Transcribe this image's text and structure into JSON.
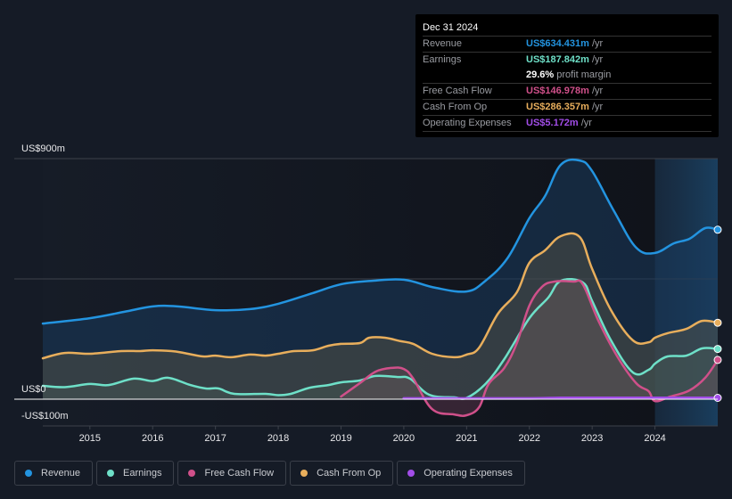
{
  "tooltip": {
    "date": "Dec 31 2024",
    "rows": [
      {
        "label": "Revenue",
        "value": "US$634.431m",
        "unit": "/yr",
        "color": "#2394e0"
      },
      {
        "label": "Earnings",
        "value": "US$187.842m",
        "unit": "/yr",
        "color": "#6ee0c8"
      },
      {
        "label": "",
        "value": "29.6%",
        "unit": "profit margin",
        "color": "#ffffff"
      },
      {
        "label": "Free Cash Flow",
        "value": "US$146.978m",
        "unit": "/yr",
        "color": "#d0508a"
      },
      {
        "label": "Cash From Op",
        "value": "US$286.357m",
        "unit": "/yr",
        "color": "#e8ae5c"
      },
      {
        "label": "Operating Expenses",
        "value": "US$5.172m",
        "unit": "/yr",
        "color": "#a24de8"
      }
    ]
  },
  "legend": [
    {
      "label": "Revenue",
      "color": "#2394e0"
    },
    {
      "label": "Earnings",
      "color": "#6ee0c8"
    },
    {
      "label": "Free Cash Flow",
      "color": "#d0508a"
    },
    {
      "label": "Cash From Op",
      "color": "#e8ae5c"
    },
    {
      "label": "Operating Expenses",
      "color": "#a24de8"
    }
  ],
  "chart_data": {
    "type": "area",
    "title": "",
    "xlabel": "",
    "ylabel": "",
    "ylim": [
      -100,
      900
    ],
    "xlim": [
      2014.25,
      2025.0
    ],
    "y_tick_labels": [
      {
        "value": 900,
        "label": "US$900m"
      },
      {
        "value": 0,
        "label": "US$0"
      },
      {
        "value": -100,
        "label": "-US$100m"
      }
    ],
    "gridlines": [
      900,
      450
    ],
    "x_ticks": [
      2015,
      2016,
      2017,
      2018,
      2019,
      2020,
      2021,
      2022,
      2023,
      2024
    ],
    "highlight_from": 2024.0,
    "units": "US$ millions",
    "series": [
      {
        "name": "Revenue",
        "color": "#2394e0",
        "x": [
          2014.25,
          2015.0,
          2015.55,
          2016.0,
          2016.4,
          2017.0,
          2017.55,
          2018.0,
          2018.55,
          2019.0,
          2019.5,
          2020.0,
          2020.5,
          2021.0,
          2021.3,
          2021.65,
          2022.0,
          2022.25,
          2022.5,
          2022.8,
          2023.0,
          2023.35,
          2023.7,
          2024.0,
          2024.3,
          2024.55,
          2024.8,
          2025.0
        ],
        "values": [
          283,
          303,
          327,
          347,
          347,
          333,
          337,
          357,
          397,
          430,
          443,
          447,
          417,
          403,
          443,
          527,
          677,
          760,
          877,
          893,
          853,
          703,
          567,
          547,
          583,
          600,
          640,
          634
        ]
      },
      {
        "name": "Earnings",
        "color": "#6ee0c8",
        "x": [
          2014.25,
          2014.6,
          2015.0,
          2015.3,
          2015.7,
          2016.0,
          2016.25,
          2016.6,
          2016.85,
          2017.05,
          2017.3,
          2017.8,
          2018.0,
          2018.2,
          2018.5,
          2018.8,
          2019.0,
          2019.3,
          2019.55,
          2019.9,
          2020.1,
          2020.4,
          2020.8,
          2021.0,
          2021.3,
          2021.6,
          2022.0,
          2022.3,
          2022.5,
          2022.85,
          2023.0,
          2023.3,
          2023.65,
          2023.9,
          2024.0,
          2024.2,
          2024.5,
          2024.75,
          2025.0
        ],
        "values": [
          50,
          45,
          57,
          53,
          77,
          68,
          80,
          53,
          40,
          40,
          20,
          20,
          15,
          20,
          43,
          53,
          63,
          70,
          87,
          83,
          77,
          17,
          7,
          5,
          57,
          150,
          303,
          380,
          443,
          437,
          367,
          220,
          100,
          110,
          133,
          160,
          163,
          190,
          188
        ]
      },
      {
        "name": "Free Cash Flow",
        "color": "#d0508a",
        "x": [
          2019.0,
          2019.3,
          2019.55,
          2019.8,
          2020.0,
          2020.15,
          2020.45,
          2020.8,
          2021.0,
          2021.2,
          2021.35,
          2021.6,
          2021.8,
          2022.0,
          2022.2,
          2022.4,
          2022.7,
          2022.85,
          2023.1,
          2023.4,
          2023.7,
          2023.9,
          2024.0,
          2024.25,
          2024.55,
          2024.8,
          2025.0
        ],
        "values": [
          10,
          60,
          103,
          117,
          113,
          77,
          -37,
          -57,
          -60,
          -30,
          57,
          117,
          210,
          350,
          420,
          440,
          440,
          430,
          293,
          160,
          60,
          30,
          -7,
          10,
          33,
          80,
          147
        ]
      },
      {
        "name": "Cash From Op",
        "color": "#e8ae5c",
        "x": [
          2014.25,
          2014.6,
          2015.0,
          2015.5,
          2015.8,
          2016.0,
          2016.3,
          2016.5,
          2016.8,
          2017.0,
          2017.25,
          2017.55,
          2017.8,
          2018.0,
          2018.25,
          2018.55,
          2018.8,
          2019.0,
          2019.3,
          2019.45,
          2019.7,
          2019.95,
          2020.15,
          2020.45,
          2020.8,
          2021.0,
          2021.2,
          2021.5,
          2021.8,
          2022.0,
          2022.25,
          2022.5,
          2022.8,
          2023.0,
          2023.3,
          2023.65,
          2023.9,
          2024.0,
          2024.2,
          2024.5,
          2024.75,
          2025.0
        ],
        "values": [
          153,
          173,
          170,
          180,
          180,
          183,
          180,
          173,
          160,
          163,
          157,
          167,
          163,
          170,
          180,
          183,
          200,
          207,
          210,
          230,
          230,
          217,
          207,
          170,
          157,
          167,
          193,
          320,
          400,
          510,
          557,
          610,
          607,
          487,
          333,
          220,
          213,
          230,
          247,
          263,
          293,
          286
        ]
      },
      {
        "name": "Operating Expenses",
        "color": "#a24de8",
        "x": [
          2020.0,
          2021.0,
          2022.0,
          2022.5,
          2023.0,
          2024.0,
          2025.0
        ],
        "values": [
          3,
          3,
          3,
          5,
          5,
          5,
          5
        ]
      }
    ]
  }
}
